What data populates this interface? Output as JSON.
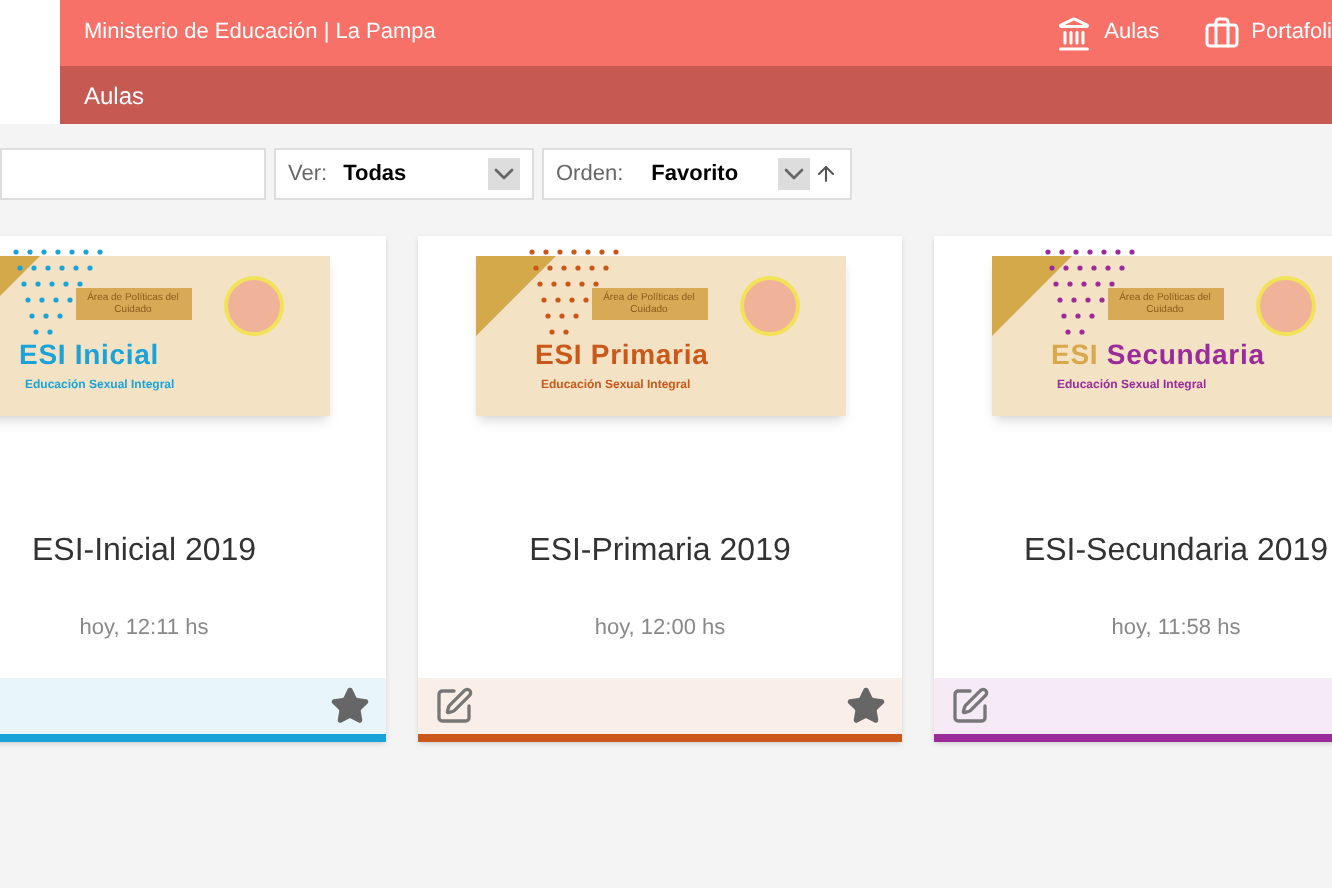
{
  "header": {
    "title": "Ministerio de Educación | La Pampa",
    "nav": [
      {
        "label": "Aulas",
        "kind": "building"
      },
      {
        "label": "Portafoli",
        "kind": "briefcase"
      }
    ]
  },
  "subheader": {
    "title": "Aulas"
  },
  "toolbar": {
    "view": {
      "label": "Ver:",
      "value": "Todas"
    },
    "order": {
      "label": "Orden:",
      "value": "Favorito"
    }
  },
  "cards": [
    {
      "banner": {
        "tag": "Área de Políticas del Cuidado",
        "heading_1": "ESI",
        "heading_2": "Inicial",
        "subtitle": "Educación Sexual Integral"
      },
      "title": "ESI-Inicial 2019",
      "time": "hoy, 12:11 hs",
      "color": "#1aa3d9",
      "favorite": true,
      "editable": false
    },
    {
      "banner": {
        "tag": "Área de Políticas del Cuidado",
        "heading_1": "ESI",
        "heading_2": "Primaria",
        "subtitle": "Educación Sexual Integral"
      },
      "title": "ESI-Primaria 2019",
      "time": "hoy, 12:00 hs",
      "color": "#c9581a",
      "favorite": true,
      "editable": true
    },
    {
      "banner": {
        "tag": "Área de Políticas del Cuidado",
        "heading_1": "ESI",
        "heading_2": "Secundaria",
        "subtitle": "Educación Sexual Integral"
      },
      "title": "ESI-Secundaria 2019",
      "time": "hoy, 11:58 hs",
      "color": "#9b2a9b",
      "favorite": false,
      "editable": true
    }
  ]
}
